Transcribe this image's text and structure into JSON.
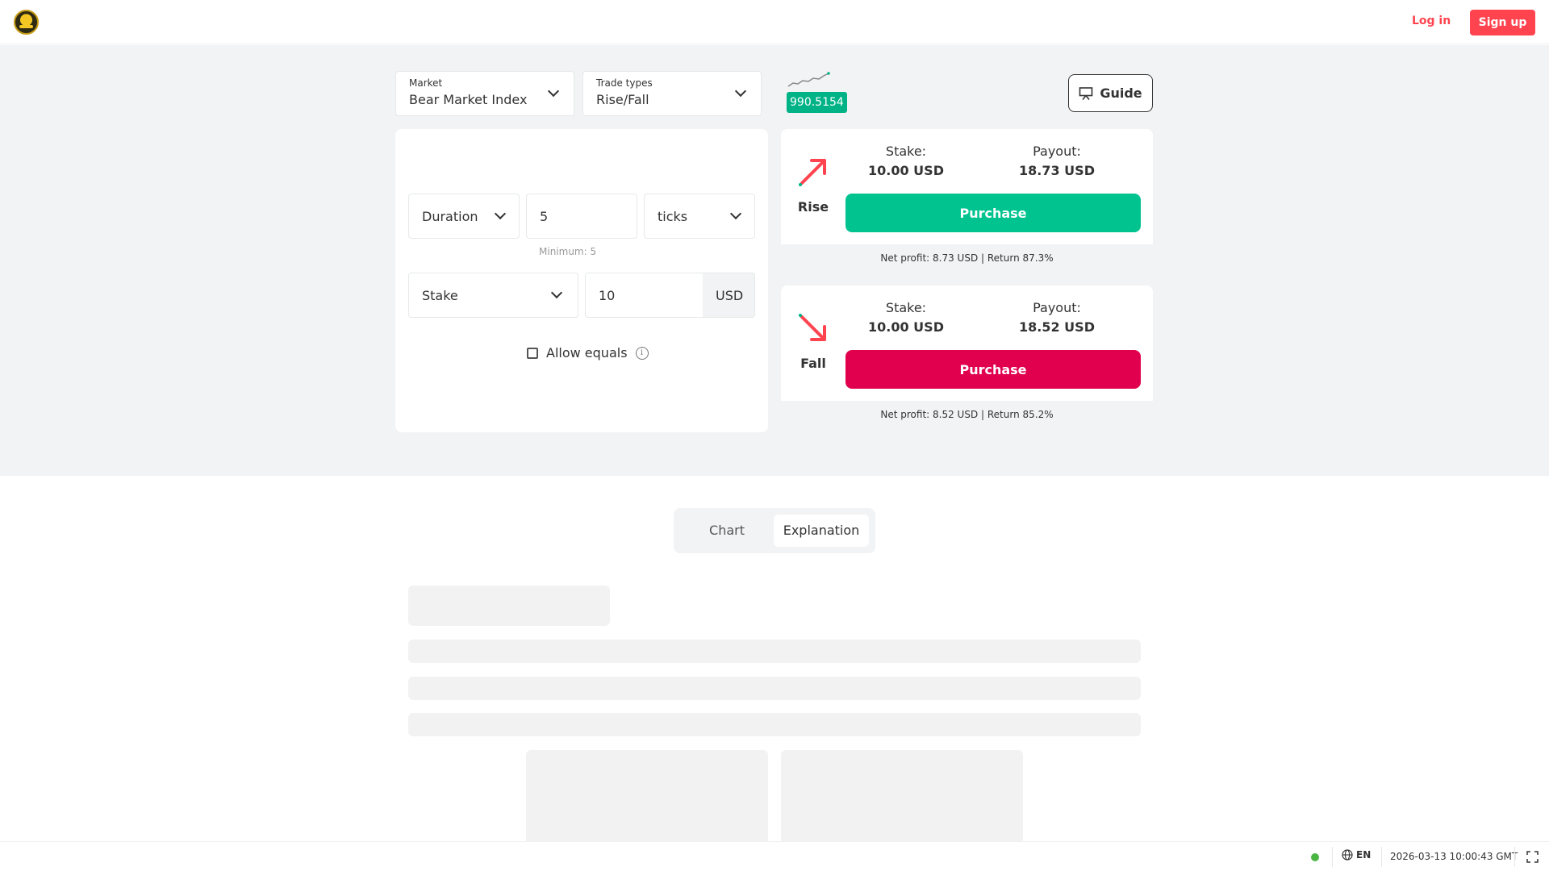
{
  "header": {
    "login_label": "Log in",
    "signup_label": "Sign up"
  },
  "market": {
    "label": "Market",
    "value": "Bear Market Index"
  },
  "trade_type": {
    "label": "Trade types",
    "value": "Rise/Fall"
  },
  "price": "990.5154",
  "guide_label": "Guide",
  "form": {
    "duration_type": "Duration",
    "duration_value": "5",
    "duration_unit": "ticks",
    "duration_min": "Minimum: 5",
    "amount_type": "Stake",
    "amount_value": "10",
    "currency": "USD",
    "allow_equals": "Allow equals"
  },
  "rise": {
    "label": "Rise",
    "stake_label": "Stake:",
    "stake_value": "10.00 USD",
    "payout_label": "Payout:",
    "payout_value": "18.73 USD",
    "button": "Purchase",
    "footer": "Net profit: 8.73 USD | Return 87.3%"
  },
  "fall": {
    "label": "Fall",
    "stake_label": "Stake:",
    "stake_value": "10.00 USD",
    "payout_label": "Payout:",
    "payout_value": "18.52 USD",
    "button": "Purchase",
    "footer": "Net profit: 8.52 USD | Return 85.2%"
  },
  "tabs": {
    "chart": "Chart",
    "explanation": "Explanation"
  },
  "footer": {
    "language": "EN",
    "datetime": "2026-03-13 10:00:43 GMT"
  },
  "colors": {
    "brand_red": "#ff444f",
    "rise_green": "#00c390",
    "fall_red": "#e0004d",
    "price_green": "#00b386"
  }
}
